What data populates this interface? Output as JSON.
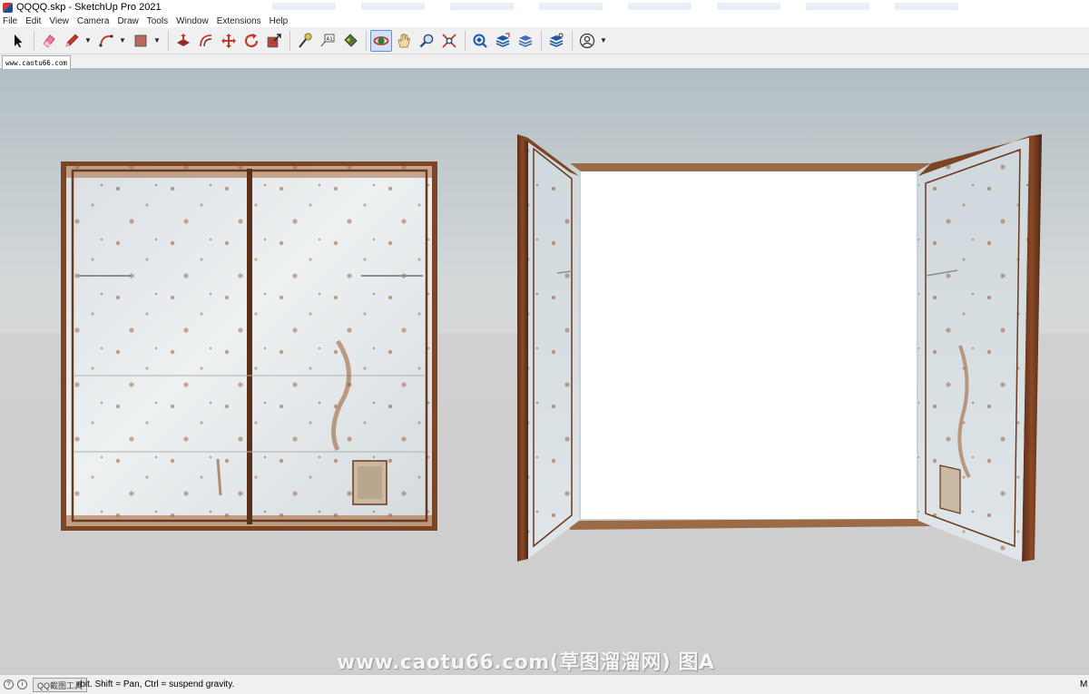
{
  "window": {
    "title": "QQQQ.skp - SketchUp Pro 2021"
  },
  "menu": [
    "File",
    "Edit",
    "View",
    "Camera",
    "Draw",
    "Tools",
    "Window",
    "Extensions",
    "Help"
  ],
  "toolbar": [
    {
      "icon": "select-arrow-icon"
    },
    {
      "icon": "eraser-icon"
    },
    {
      "icon": "pencil-line-icon",
      "dropdown": true
    },
    {
      "icon": "arc-shape-icon",
      "dropdown": true
    },
    {
      "icon": "rectangle-shape-icon",
      "dropdown": true
    },
    {
      "icon": "push-pull-icon"
    },
    {
      "icon": "offset-icon"
    },
    {
      "icon": "move-icon"
    },
    {
      "icon": "rotate-icon"
    },
    {
      "icon": "scale-icon"
    },
    {
      "icon": "tape-measure-icon"
    },
    {
      "icon": "text-label-icon"
    },
    {
      "icon": "paint-bucket-icon"
    },
    {
      "icon": "orbit-icon",
      "active": true
    },
    {
      "icon": "pan-hand-icon"
    },
    {
      "icon": "zoom-icon"
    },
    {
      "icon": "zoom-extents-icon"
    },
    {
      "icon": "3d-warehouse-icon"
    },
    {
      "icon": "extension-warehouse-icon"
    },
    {
      "icon": "layout-send-icon"
    },
    {
      "icon": "extension-manager-icon"
    },
    {
      "icon": "account-icon",
      "dropdown": true
    }
  ],
  "tab": {
    "label": "www.caotu66.com"
  },
  "viewport": {
    "watermark": "www.caotu66.com(草图溜溜网) 图A"
  },
  "status": {
    "chip": "QQ截图工具",
    "text": "rbit. Shift = Pan, Ctrl = suspend gravity.",
    "measure_label": "M"
  },
  "colors": {
    "sky": "#b2bec3",
    "ground": "#cdcecd",
    "rust": "#8a4a1f",
    "panel": "#dfe4e7"
  }
}
